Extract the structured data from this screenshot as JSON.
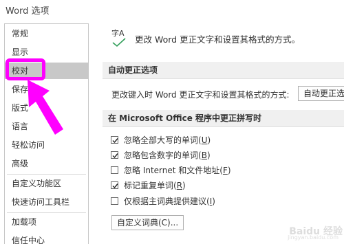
{
  "window": {
    "title": "Word 选项"
  },
  "sidebar": {
    "items": [
      {
        "label": "常规"
      },
      {
        "label": "显示"
      },
      {
        "label": "校对",
        "selected": true
      },
      {
        "label": "保存"
      },
      {
        "label": "版式"
      },
      {
        "label": "语言"
      },
      {
        "label": "轻松访问"
      },
      {
        "label": "高级"
      },
      {
        "label": "自定义功能区"
      },
      {
        "label": "快速访问工具栏"
      },
      {
        "label": "加载项"
      },
      {
        "label": "信任中心"
      }
    ]
  },
  "main": {
    "header": {
      "icon": "abc-check-icon",
      "icon_text": "字A",
      "text": "更改 Word 更正文字和设置其格式的方式。"
    },
    "autocorrect": {
      "title": "自动更正选项",
      "label": "更改键入时 Word 更正文字和设置其格式的方式:",
      "button": "自动更正选"
    },
    "spelling": {
      "title": "在 Microsoft Office 程序中更正拼写时",
      "options": [
        {
          "label": "忽略全部大写的单词",
          "key": "U",
          "checked": true
        },
        {
          "label": "忽略包含数字的单词",
          "key": "B",
          "checked": true
        },
        {
          "label": "忽略 Internet 和文件地址",
          "key": "F",
          "checked": false
        },
        {
          "label": "标记重复单词",
          "key": "R",
          "checked": true
        },
        {
          "label": "仅根据主词典提供建议",
          "key": "I",
          "checked": false
        }
      ],
      "dictionary_button": "自定义词典(C)..."
    }
  },
  "overlay": {
    "highlight_color": "#ff00ff"
  },
  "watermark": {
    "text": "Baidu 经验",
    "sub": "jingyan.baidu.com"
  }
}
